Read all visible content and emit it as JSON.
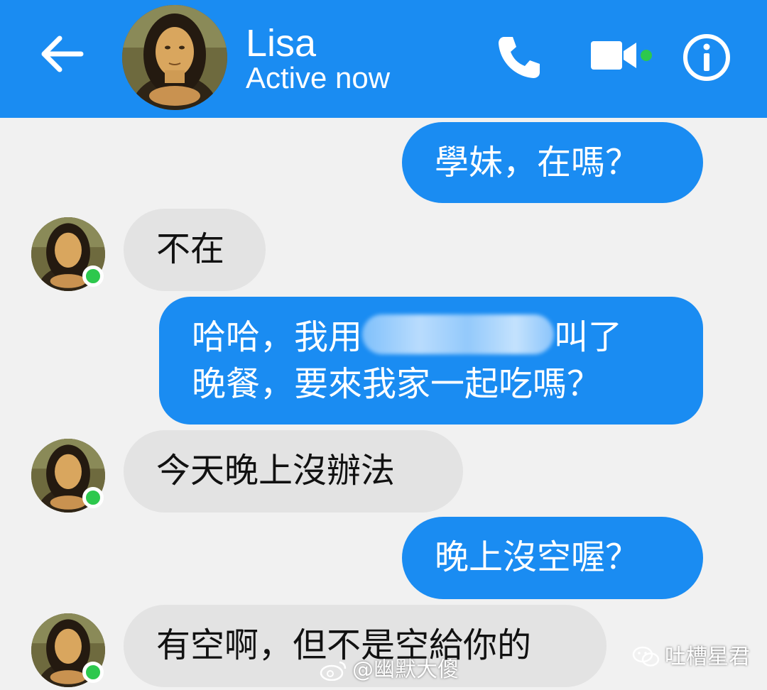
{
  "header": {
    "contact_name": "Lisa",
    "presence": "Active now",
    "icons": [
      "back-arrow-icon",
      "avatar",
      "phone-icon",
      "video-camera-icon",
      "info-icon"
    ]
  },
  "messages": [
    {
      "direction": "outgoing",
      "lines": [
        "學妹，在嗎？"
      ]
    },
    {
      "direction": "incoming",
      "lines": [
        "不在"
      ]
    },
    {
      "direction": "outgoing",
      "lines": [
        "哈哈，我用",
        "叫了",
        "晚餐，要來我家一起吃嗎？"
      ],
      "redacted": true
    },
    {
      "direction": "incoming",
      "lines": [
        "今天晚上沒辦法"
      ]
    },
    {
      "direction": "outgoing",
      "lines": [
        "晚上沒空喔？"
      ]
    },
    {
      "direction": "incoming",
      "lines": [
        "有空啊，但不是空給你的"
      ]
    }
  ],
  "watermarks": {
    "weibo": "@幽默大傻",
    "wechat": "吐槽星君"
  },
  "colors": {
    "accent_blue": "#1a8cf2",
    "incoming_bubble": "#e3e3e3",
    "background": "#f1f1f1",
    "online_green": "#2dc84d"
  }
}
